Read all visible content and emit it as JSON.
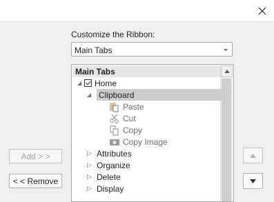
{
  "dialog": {
    "close_icon": "close-icon"
  },
  "customize_label": "Customize the Ribbon:",
  "ribbon_select": {
    "value": "Main Tabs"
  },
  "tree": {
    "header": "Main Tabs",
    "items": [
      {
        "label": "Home",
        "checked": true,
        "expanded": true
      },
      {
        "label": "Clipboard",
        "selected": true
      },
      {
        "label": "Paste",
        "icon": "paste-icon"
      },
      {
        "label": "Cut",
        "icon": "scissors-icon"
      },
      {
        "label": "Copy",
        "icon": "copy-icon"
      },
      {
        "label": "Copy Image",
        "icon": "camera-icon"
      },
      {
        "label": "Attributes"
      },
      {
        "label": "Organize"
      },
      {
        "label": "Delete"
      },
      {
        "label": "Display"
      }
    ]
  },
  "buttons": {
    "add": "Add > >",
    "remove": "< < Remove"
  }
}
